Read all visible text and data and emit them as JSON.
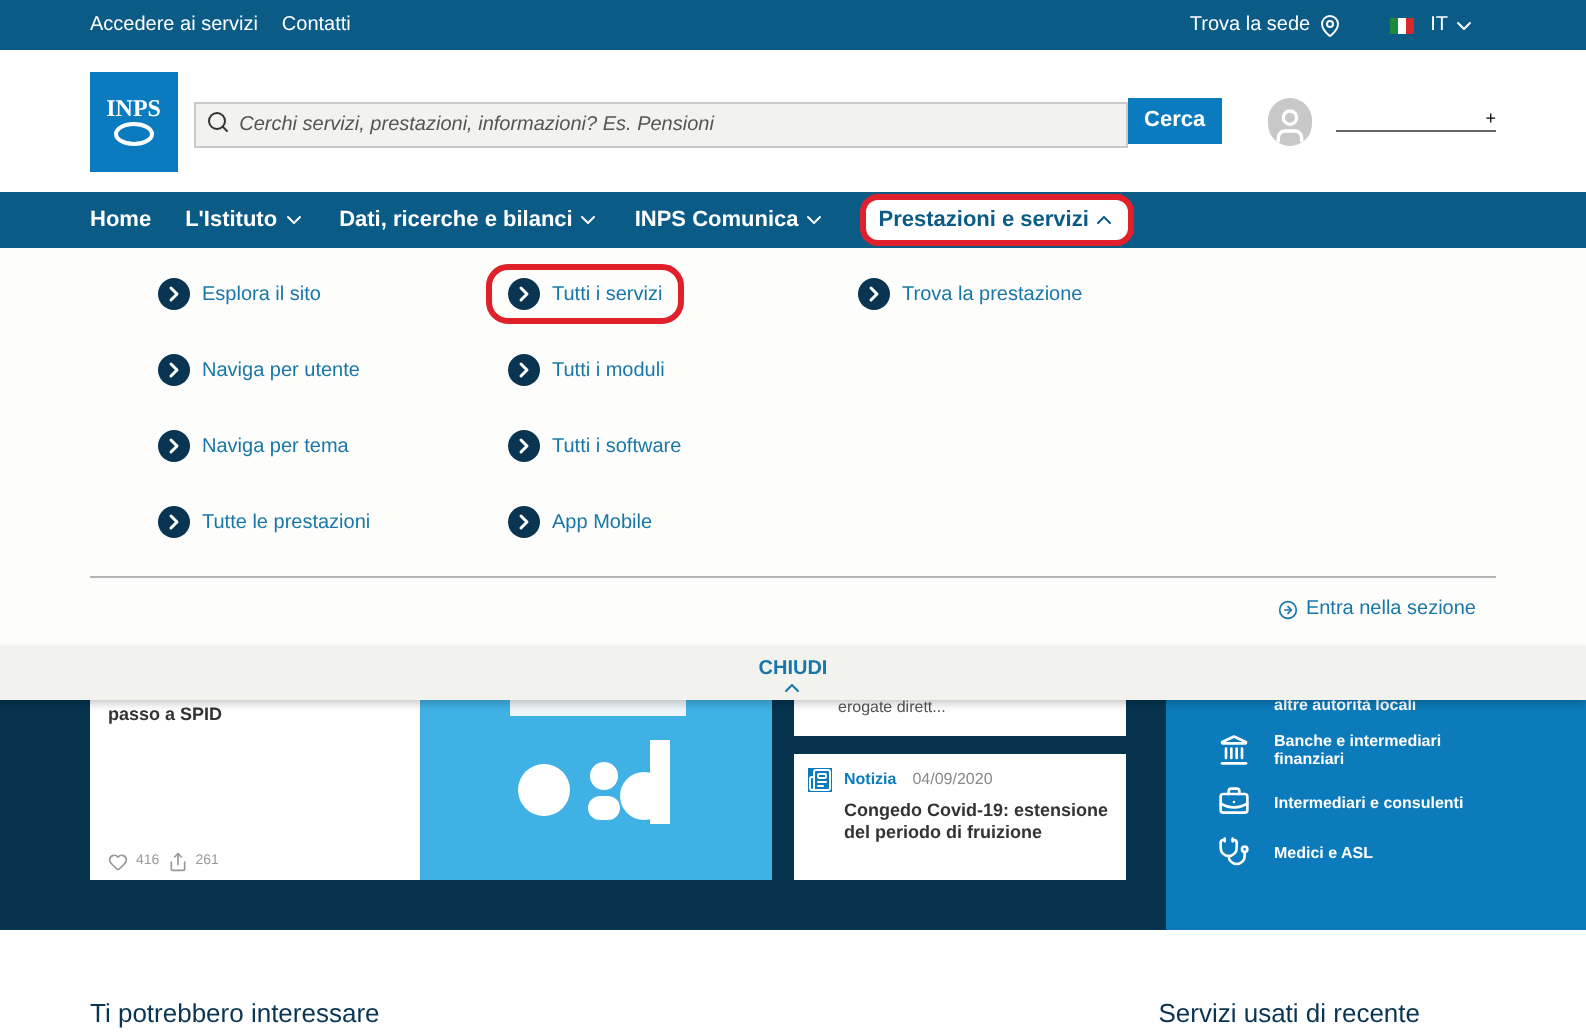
{
  "top_bar": {
    "links": [
      "Accedere ai servizi",
      "Contatti"
    ],
    "find_office": "Trova la sede",
    "language": "IT"
  },
  "header": {
    "logo": "INPS",
    "search": {
      "placeholder": "Cerchi servizi, prestazioni, informazioni? Es. Pensioni"
    },
    "search_button": "Cerca",
    "login_plus": "+"
  },
  "nav": [
    {
      "label": "Home",
      "dropdown": false,
      "selected": false,
      "highlighted": false
    },
    {
      "label": "L'Istituto",
      "dropdown": true,
      "selected": false,
      "highlighted": false
    },
    {
      "label": "Dati, ricerche e bilanci",
      "dropdown": true,
      "selected": false,
      "highlighted": false
    },
    {
      "label": "INPS Comunica",
      "dropdown": true,
      "selected": false,
      "highlighted": false
    },
    {
      "label": "Prestazioni e servizi",
      "dropdown": true,
      "selected": true,
      "highlighted": true
    }
  ],
  "menu": {
    "columns": [
      [
        {
          "label": "Esplora il sito",
          "highlighted": false
        },
        {
          "label": "Naviga per utente",
          "highlighted": false
        },
        {
          "label": "Naviga per tema",
          "highlighted": false
        },
        {
          "label": "Tutte le prestazioni",
          "highlighted": false
        }
      ],
      [
        {
          "label": "Tutti i servizi",
          "highlighted": true
        },
        {
          "label": "Tutti i moduli",
          "highlighted": false
        },
        {
          "label": "Tutti i software",
          "highlighted": false
        },
        {
          "label": "App Mobile",
          "highlighted": false
        }
      ],
      [
        {
          "label": "Trova la prestazione",
          "highlighted": false
        }
      ]
    ],
    "enter_section": "Entra nella sezione",
    "close": "CHIUDI"
  },
  "hero": {
    "card_text": "passo a SPID",
    "likes": "416",
    "shares": "261",
    "news_top_text": "erogate dirett...",
    "news": {
      "kind": "Notizia",
      "date": "04/09/2020",
      "title": "Congedo Covid-19: estensione del periodo di fruizione"
    },
    "users": [
      {
        "label": "altre autorità locali"
      },
      {
        "label": "Banche e intermediari finanziari"
      },
      {
        "label": "Intermediari e consulenti"
      },
      {
        "label": "Medici e ASL"
      }
    ]
  },
  "sections": [
    "Ti potrebbero interessare",
    "Servizi usati di recente"
  ]
}
